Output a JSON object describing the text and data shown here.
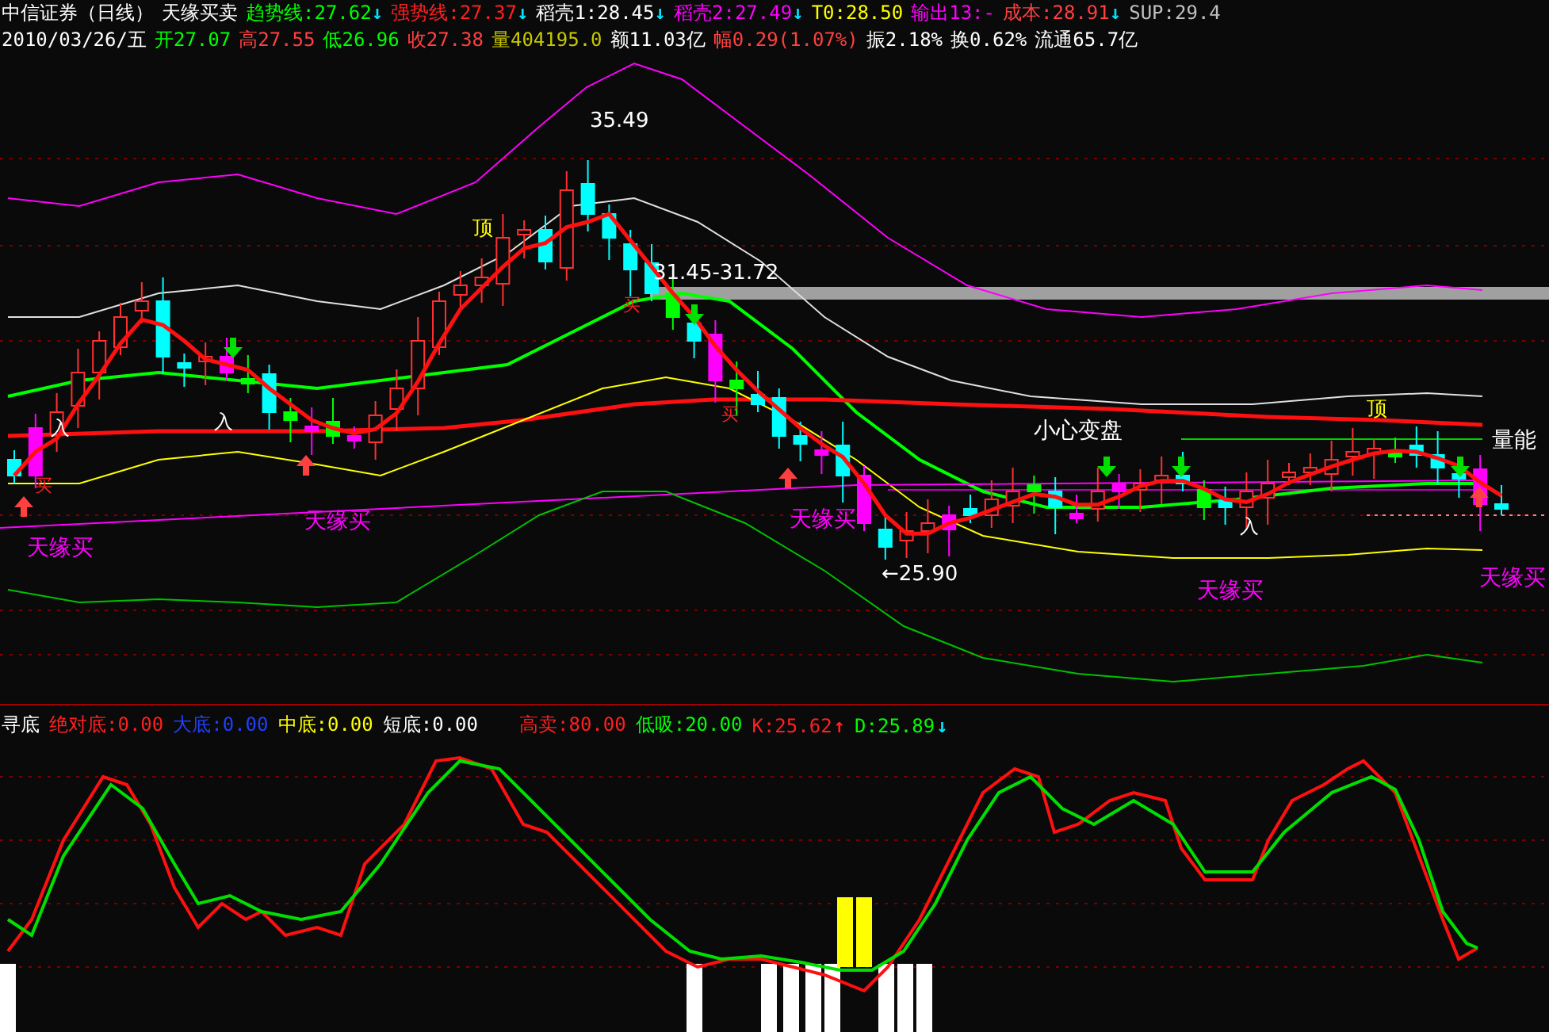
{
  "header": {
    "title": "中信证券（日线）",
    "indicator": "天缘买卖",
    "readings": [
      {
        "label": "趋势线:27.62",
        "color": "#00ff00",
        "arrow": {
          "glyph": "↓",
          "color": "#00e5ff"
        }
      },
      {
        "label": "强势线:27.37",
        "color": "#ff2020",
        "arrow": {
          "glyph": "↓",
          "color": "#00e5ff"
        }
      },
      {
        "label": "稻壳1:28.45",
        "color": "#ffffff",
        "arrow": {
          "glyph": "↓",
          "color": "#00e5ff"
        }
      },
      {
        "label": "稻壳2:27.49",
        "color": "#ff00ff",
        "arrow": {
          "glyph": "↓",
          "color": "#00e5ff"
        }
      },
      {
        "label": "T0:28.50",
        "color": "#ffff00"
      },
      {
        "label": "输出13:-",
        "color": "#ff00ff"
      },
      {
        "label": "成本:28.91",
        "color": "#ff4040",
        "arrow": {
          "glyph": "↓",
          "color": "#00e5ff"
        }
      },
      {
        "label": "SUP:29.4",
        "color": "#c0c0c0"
      }
    ]
  },
  "quote": [
    {
      "text": "2010/03/26/五",
      "color": "#ffffff"
    },
    {
      "text": "开27.07",
      "color": "#00ff00"
    },
    {
      "text": "高27.55",
      "color": "#ff4040"
    },
    {
      "text": "低26.96",
      "color": "#00ff00"
    },
    {
      "text": "收27.38",
      "color": "#ff4040"
    },
    {
      "text": "量404195.0",
      "color": "#c8c800"
    },
    {
      "text": "额11.03亿",
      "color": "#ffffff"
    },
    {
      "text": "幅0.29(1.07%)",
      "color": "#ff4040"
    },
    {
      "text": "振2.18%",
      "color": "#ffffff"
    },
    {
      "text": "换0.62%",
      "color": "#ffffff"
    },
    {
      "text": "流通65.7亿",
      "color": "#ffffff"
    }
  ],
  "chart": {
    "labels": [
      {
        "text": "35.49",
        "kind": "price"
      },
      {
        "text": "顶",
        "kind": "top"
      },
      {
        "text": "31.45-31.72",
        "kind": "price"
      },
      {
        "text": "买",
        "kind": "buy"
      },
      {
        "text": "买",
        "kind": "buy"
      },
      {
        "text": "入",
        "kind": "enter"
      },
      {
        "text": "入",
        "kind": "enter"
      },
      {
        "text": "买",
        "kind": "buy"
      },
      {
        "text": "天缘买",
        "kind": "signal"
      },
      {
        "text": "天缘买",
        "kind": "signal"
      },
      {
        "text": "小心变盘",
        "kind": "warning"
      },
      {
        "text": "顶",
        "kind": "top"
      },
      {
        "text": "量能",
        "kind": "warning"
      },
      {
        "text": "天缘买",
        "kind": "signal"
      },
      {
        "text": "←25.90",
        "kind": "price"
      },
      {
        "text": "入",
        "kind": "enter"
      },
      {
        "text": "天缘买",
        "kind": "signal"
      },
      {
        "text": "天缘买",
        "kind": "signal"
      }
    ]
  },
  "oscillator": {
    "readings": [
      {
        "label": "寻底",
        "color": "#ffffff"
      },
      {
        "label": "绝对底:0.00",
        "color": "#ff2020"
      },
      {
        "label": "大底:0.00",
        "color": "#2040ff"
      },
      {
        "label": "中底:0.00",
        "color": "#ffff00"
      },
      {
        "label": "短底:0.00",
        "color": "#ffffff"
      },
      {
        "label": "高卖:80.00",
        "color": "#ff2020"
      },
      {
        "label": "低吸:20.00",
        "color": "#00ff00"
      },
      {
        "label": "K:25.62",
        "color": "#ff2020",
        "arrow": {
          "glyph": "↑",
          "color": "#ff2020"
        }
      },
      {
        "label": "D:25.89",
        "color": "#00ff00",
        "arrow": {
          "glyph": "↓",
          "color": "#00e5ff"
        }
      }
    ]
  }
}
